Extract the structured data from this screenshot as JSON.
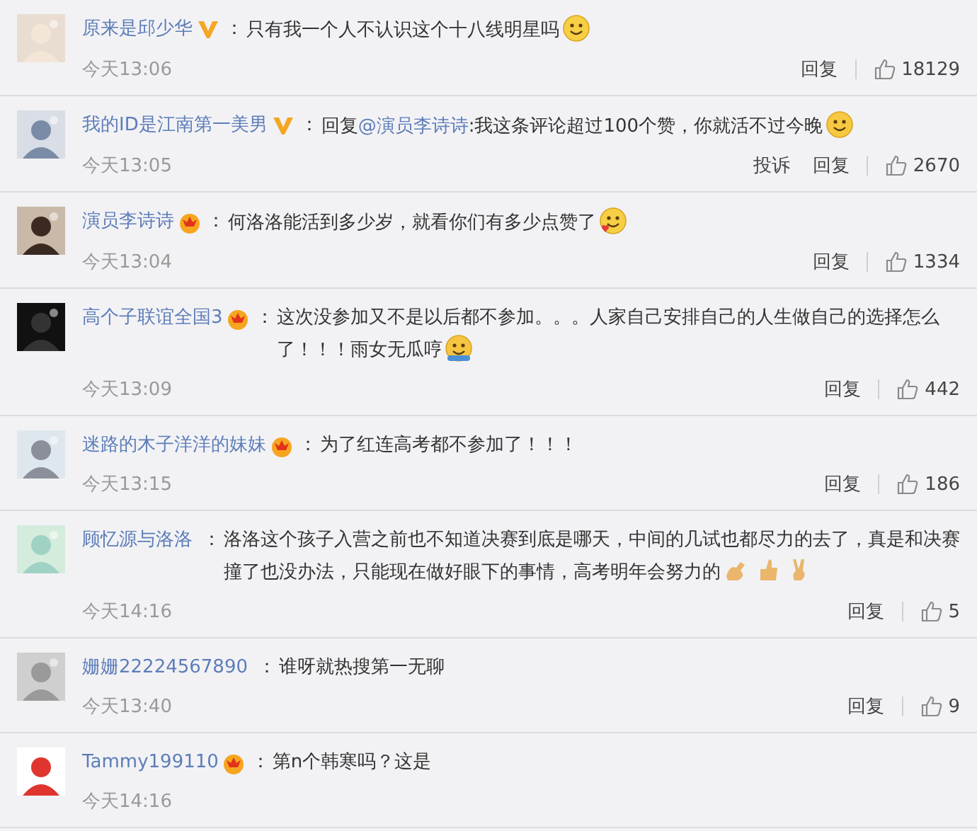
{
  "comments": [
    {
      "user": "原来是邱少华",
      "badge": {
        "kind": "verified"
      },
      "separator": "：",
      "text": "只有我一个人不认识这个十八线明星吗",
      "emojis": [
        {
          "kind": "smile"
        }
      ],
      "time": "今天13:06",
      "actions": [
        "回复"
      ],
      "likes": "18129"
    },
    {
      "user": "我的ID是江南第一美男",
      "badge": {
        "kind": "verified"
      },
      "separator": "：",
      "reply_prefix": "回复",
      "mention": "@演员李诗诗",
      "text": ":我这条评论超过100个赞，你就活不过今晚",
      "emojis": [
        {
          "kind": "blush"
        }
      ],
      "time": "今天13:05",
      "actions": [
        "投诉",
        "回复"
      ],
      "likes": "2670"
    },
    {
      "user": "演员李诗诗",
      "badge": {
        "kind": "crown"
      },
      "separator": "：",
      "text": "何洛洛能活到多少岁，就看你们有多少点赞了",
      "emojis": [
        {
          "kind": "heart"
        }
      ],
      "time": "今天13:04",
      "actions": [
        "回复"
      ],
      "likes": "1334"
    },
    {
      "user": "高个子联谊全国3",
      "badge": {
        "kind": "crown"
      },
      "separator": "：",
      "text": "这次没参加又不是以后都不参加。。。人家自己安排自己的人生做自己的选择怎么了！！！雨女无瓜哼",
      "emojis": [
        {
          "kind": "shrug"
        }
      ],
      "time": "今天13:09",
      "actions": [
        "回复"
      ],
      "likes": "442"
    },
    {
      "user": "迷路的木子洋洋的妹妹",
      "badge": {
        "kind": "crown"
      },
      "separator": "：",
      "text": "为了红连高考都不参加了！！！",
      "time": "今天13:15",
      "actions": [
        "回复"
      ],
      "likes": "186"
    },
    {
      "user": "顾忆源与洛洛",
      "separator": "：",
      "text": "洛洛这个孩子入营之前也不知道决赛到底是哪天，中间的几试也都尽力的去了，真是和决赛撞了也没办法，只能现在做好眼下的事情，高考明年会努力的",
      "emojis": [
        {
          "kind": "muscle"
        },
        {
          "kind": "thumbsup"
        },
        {
          "kind": "victory"
        }
      ],
      "time": "今天14:16",
      "actions": [
        "回复"
      ],
      "likes": "5"
    },
    {
      "user": "姗姗22224567890",
      "separator": "：",
      "text": "谁呀就热搜第一无聊",
      "time": "今天13:40",
      "actions": [
        "回复"
      ],
      "likes": "9"
    },
    {
      "user": "Tammy199110",
      "badge": {
        "kind": "crown"
      },
      "separator": "：",
      "text": "第n个韩寒吗？这是",
      "time": "今天14:16"
    }
  ]
}
